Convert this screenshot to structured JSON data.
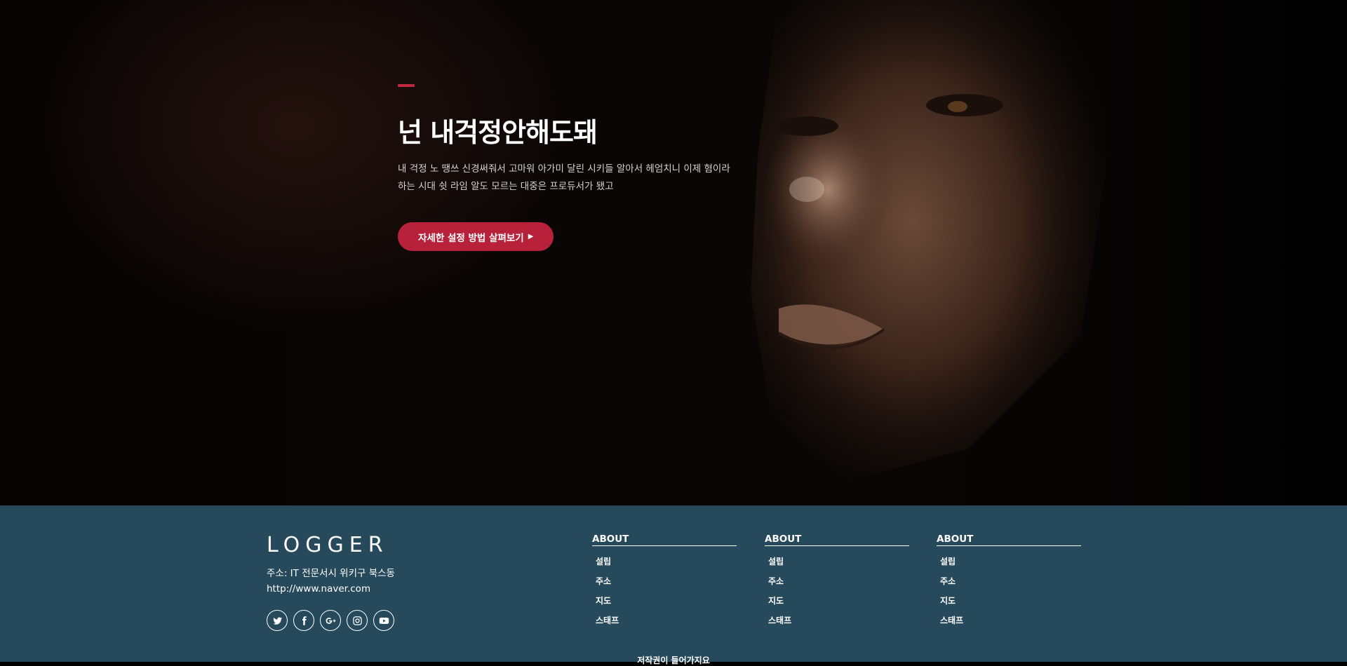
{
  "hero": {
    "title": "넌 내걱정안해도돼",
    "description": "내 걱정 노 땡쓰 신경써줘서 고마워 아가미 달린 시키들 알아서 헤엄치니 이제 혐이라 하는 시대 쉿 라임 알도 모르는 대중은 프로듀서가 됐고",
    "cta_label": "자세한 설정 방법 살펴보기",
    "accent_color": "#c0283f"
  },
  "footer": {
    "brand": "LOGGER",
    "address": "주소: IT 전문서시 위키구 북스동",
    "url": "http://www.naver.com",
    "background_color": "#264a5b",
    "socials": [
      {
        "icon": "twitter-icon"
      },
      {
        "icon": "facebook-icon"
      },
      {
        "icon": "google-plus-icon"
      },
      {
        "icon": "instagram-icon"
      },
      {
        "icon": "youtube-icon"
      }
    ],
    "columns": [
      {
        "title": "ABOUT",
        "items": [
          "설립",
          "주소",
          "지도",
          "스태프"
        ]
      },
      {
        "title": "ABOUT",
        "items": [
          "설립",
          "주소",
          "지도",
          "스태프"
        ]
      },
      {
        "title": "ABOUT",
        "items": [
          "설립",
          "주소",
          "지도",
          "스태프"
        ]
      }
    ],
    "copyright": "저작권이 들어가지요"
  }
}
